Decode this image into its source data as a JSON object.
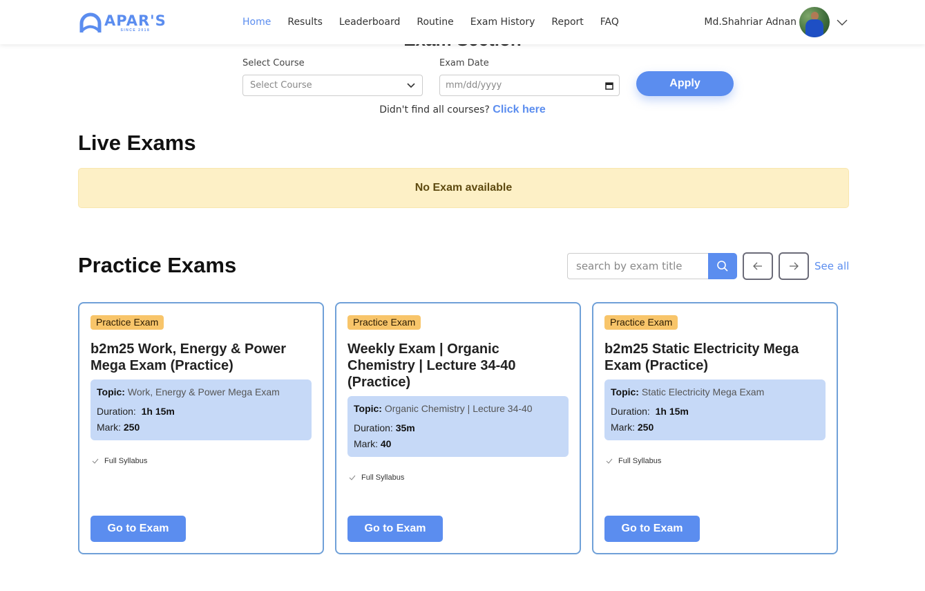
{
  "header": {
    "logo_title": "APAR'S",
    "logo_sub": "SINCE 2018",
    "nav": [
      {
        "label": "Home",
        "active": true
      },
      {
        "label": "Results",
        "active": false
      },
      {
        "label": "Leaderboard",
        "active": false
      },
      {
        "label": "Routine",
        "active": false
      },
      {
        "label": "Exam History",
        "active": false
      },
      {
        "label": "Report",
        "active": false
      },
      {
        "label": "FAQ",
        "active": false
      }
    ],
    "user_name": "Md.Shahriar Adnan"
  },
  "exam_section": {
    "title": "Exam Section",
    "course_label": "Select Course",
    "course_placeholder": "Select Course",
    "date_label": "Exam Date",
    "date_placeholder": "mm/dd/yyyy",
    "apply_label": "Apply",
    "didnt_find_text": "Didn't find all courses?",
    "click_here": "Click here"
  },
  "live_exams": {
    "title": "Live Exams",
    "empty_message": "No Exam available"
  },
  "practice_exams": {
    "title": "Practice Exams",
    "search_placeholder": "search by exam title",
    "see_all": "See all",
    "cards": [
      {
        "badge": "Practice Exam",
        "title": "b2m25 Work, Energy & Power Mega Exam (Practice)",
        "topic_label": "Topic:",
        "topic": "Work, Energy & Power Mega Exam",
        "duration_label": "Duration:",
        "duration": "1h 15m",
        "mark_label": "Mark:",
        "mark": "250",
        "syllabus": "Full Syllabus",
        "button": "Go to Exam"
      },
      {
        "badge": "Practice Exam",
        "title": "Weekly Exam | Organic Chemistry | Lecture 34-40 (Practice)",
        "topic_label": "Topic:",
        "topic": "Organic Chemistry | Lecture 34-40",
        "duration_label": "Duration:",
        "duration": "35m",
        "mark_label": "Mark:",
        "mark": "40",
        "syllabus": "Full Syllabus",
        "button": "Go to Exam"
      },
      {
        "badge": "Practice Exam",
        "title": "b2m25 Static Electricity Mega Exam (Practice)",
        "topic_label": "Topic:",
        "topic": "Static Electricity Mega Exam",
        "duration_label": "Duration:",
        "duration": "1h 15m",
        "mark_label": "Mark:",
        "mark": "250",
        "syllabus": "Full Syllabus",
        "button": "Go to Exam"
      }
    ]
  },
  "colors": {
    "accent": "#5b8def",
    "badge": "#f8c56a",
    "info_bg": "#c6d9f7",
    "alert_bg": "#fdf0c6",
    "card_border": "#6fa0d8"
  }
}
